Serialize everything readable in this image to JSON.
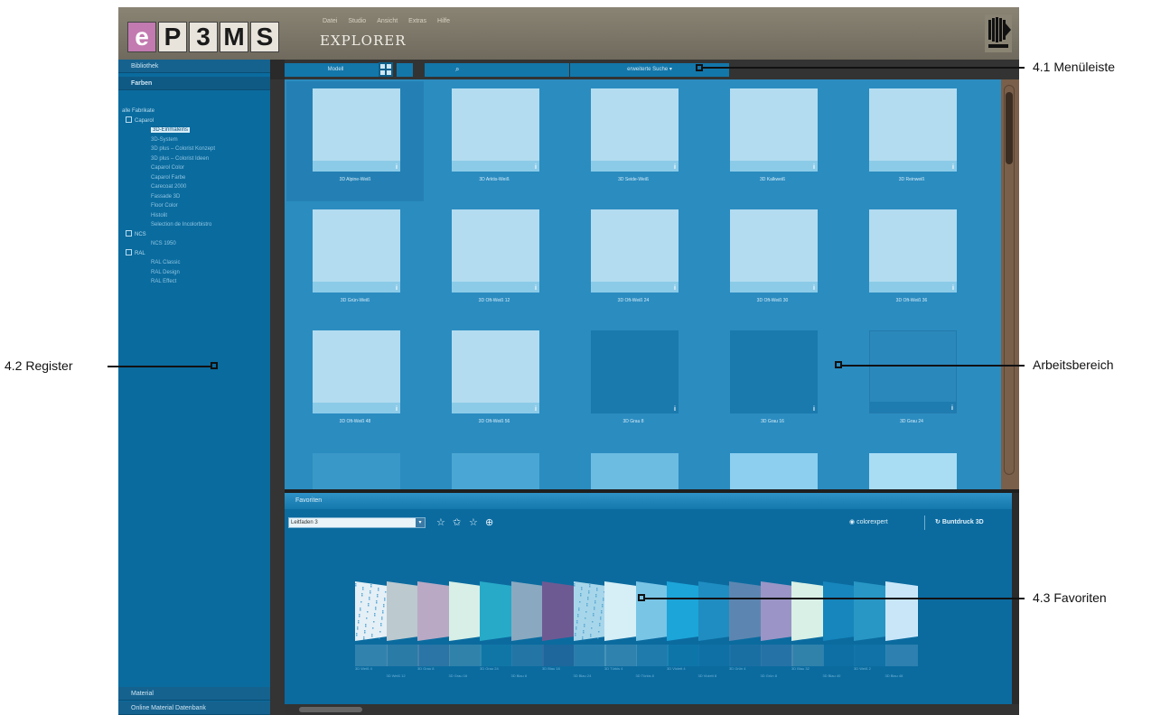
{
  "header": {
    "logo": [
      "e",
      "P",
      "3",
      "M",
      "S"
    ],
    "menu": [
      "Datei",
      "Studio",
      "Ansicht",
      "Extras",
      "Hilfe"
    ],
    "title": "EXPLORER"
  },
  "sidebar": {
    "tabs": [
      "Bibliothek",
      "Farben"
    ],
    "tree_root": "alle Fabrikate",
    "groups": [
      {
        "label": "Caparol",
        "items": [
          "3D-Einmaleins",
          "3D-System",
          "3D plus – Colorist Konzept",
          "3D plus – Colorist Ideen",
          "Caparol Color",
          "Caparol Farbe",
          "Carecoat 2000",
          "Fassade 3D",
          "Floor Color",
          "Histolit",
          "Selection de Incolorbistro"
        ]
      },
      {
        "label": "NCS",
        "items": [
          "NCS 1950"
        ]
      },
      {
        "label": "RAL",
        "items": [
          "RAL Classic",
          "RAL Design",
          "RAL Effect"
        ]
      }
    ],
    "bottom_tabs": [
      "Material",
      "Online Material Datenbank"
    ]
  },
  "toolbar": {
    "left_label": "Modell",
    "search_placeholder": "",
    "sort_label": "erweiterte Suche ▾"
  },
  "workspace": {
    "tiles": [
      {
        "caption": "3D Alpine-Weiß",
        "style": "light",
        "active": true
      },
      {
        "caption": "3D Arktis-Weiß",
        "style": "light"
      },
      {
        "caption": "3D Seide-Weiß",
        "style": "light"
      },
      {
        "caption": "3D Kalkweiß",
        "style": "light"
      },
      {
        "caption": "3D Reinweiß",
        "style": "light"
      },
      {
        "caption": "3D Grün-Weiß",
        "style": "light"
      },
      {
        "caption": "3D Oft-Weiß 12",
        "style": "light"
      },
      {
        "caption": "3D Oft-Weiß 24",
        "style": "light"
      },
      {
        "caption": "3D Oft-Weiß 30",
        "style": "light"
      },
      {
        "caption": "3D Oft-Weiß 36",
        "style": "light"
      },
      {
        "caption": "3D Oft-Weiß 48",
        "style": "light"
      },
      {
        "caption": "3D Oft-Weiß 56",
        "style": "light"
      },
      {
        "caption": "3D Grau 8",
        "style": "dark"
      },
      {
        "caption": "3D Grau 16",
        "style": "dark"
      },
      {
        "caption": "3D Grau 24",
        "style": "mid"
      }
    ],
    "peek_colors": [
      "#3a98c8",
      "#4aa6d4",
      "#6cbce2",
      "#8ccfee",
      "#a9ddf4"
    ]
  },
  "favorites": {
    "title": "Favoriten",
    "select_value": "Leitfaden 3",
    "icons": [
      "star-outline-icon",
      "star-filled-icon",
      "star-add-icon",
      "globe-icon"
    ],
    "colorlink_label": "colorexpert",
    "build_label": "Buntdruck 3D",
    "cards": [
      {
        "color": "#e4eff6",
        "pattern": true
      },
      {
        "color": "#bcc9cf"
      },
      {
        "color": "#b9a9c4"
      },
      {
        "color": "#d7efe6"
      },
      {
        "color": "#27aac8"
      },
      {
        "color": "#8aa9c0"
      },
      {
        "color": "#6e5a93"
      },
      {
        "color": "#a7d6ea",
        "pattern": true
      },
      {
        "color": "#d6eef6"
      },
      {
        "color": "#79c5e6"
      },
      {
        "color": "#1ca5d9"
      },
      {
        "color": "#1f8dc1"
      },
      {
        "color": "#5c86b1"
      },
      {
        "color": "#9a95c6"
      },
      {
        "color": "#d9f0e6"
      },
      {
        "color": "#1686bd"
      },
      {
        "color": "#2897c5"
      },
      {
        "color": "#c9e6f9"
      }
    ],
    "card_labels": [
      "3D Weiß 4",
      "3D Weiß 12",
      "3D Grau 8",
      "3D Grau 16",
      "3D Grau 24",
      "3D Blau 8",
      "3D Blau 16",
      "3D Blau 24",
      "3D Türkis 4",
      "3D Türkis 8",
      "3D Violett 4",
      "3D Violett 8",
      "3D Grün 4",
      "3D Grün 8",
      "3D Blau 32",
      "3D Blau 40",
      "3D Weiß 2",
      "3D Blau 48"
    ]
  },
  "callouts": {
    "menu": "4.1 Menüleiste",
    "register": "4.2 Register",
    "work": "Arbeitsbereich",
    "fav": "4.3 Favoriten"
  }
}
